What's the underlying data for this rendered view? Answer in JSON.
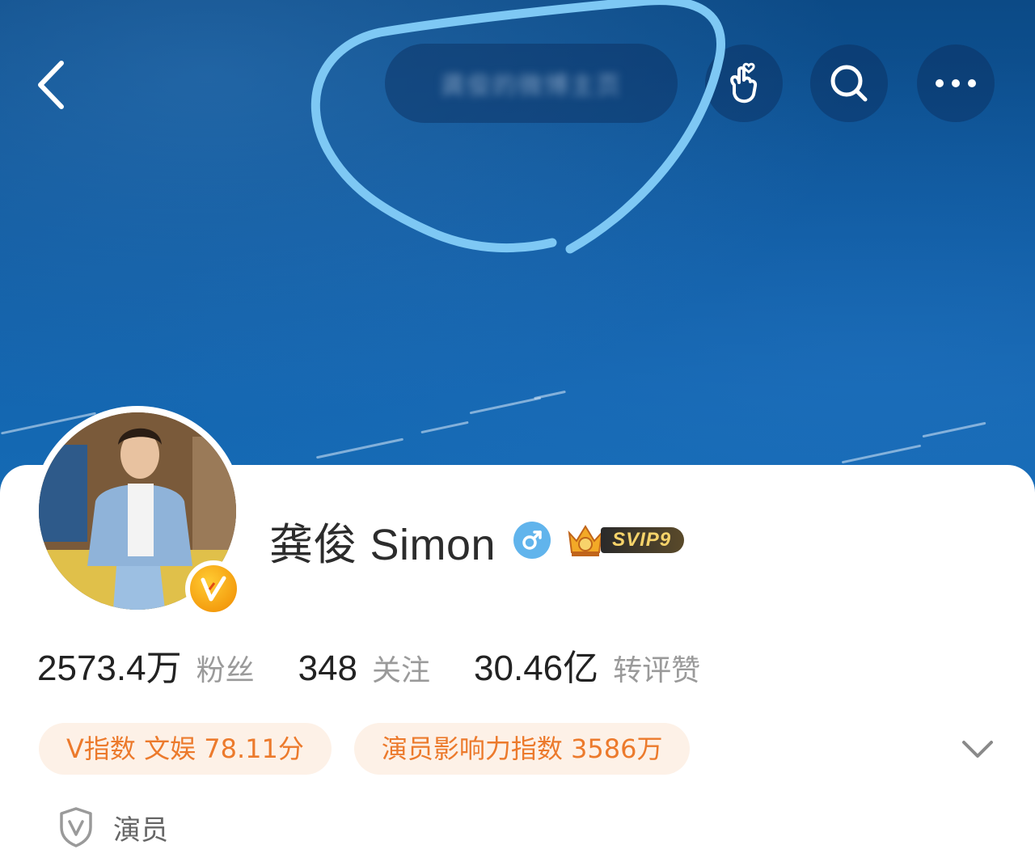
{
  "header": {
    "title": "龚俊的微博主页",
    "back_icon": "back-chevron-icon",
    "icons": [
      "hand-heart-icon",
      "search-icon",
      "more-icon"
    ]
  },
  "profile": {
    "name": "龚俊 Simon",
    "gender": "male",
    "vip_badge": "SVIP9",
    "verified_badge": "V"
  },
  "stats": [
    {
      "value": "2573.4万",
      "label": "粉丝"
    },
    {
      "value": "348",
      "label": "关注"
    },
    {
      "value": "30.46亿",
      "label": "转评赞"
    }
  ],
  "tags": [
    {
      "label": "V指数 文娱 78.11分"
    },
    {
      "label": "演员影响力指数 3586万"
    }
  ],
  "role": {
    "label": "演员",
    "icon": "verified-shield-icon"
  },
  "colors": {
    "accent": "#ec7a2c",
    "tag_bg": "#fdf1e7",
    "gender": "#61b4ec",
    "cover": "#0f5aa0"
  }
}
